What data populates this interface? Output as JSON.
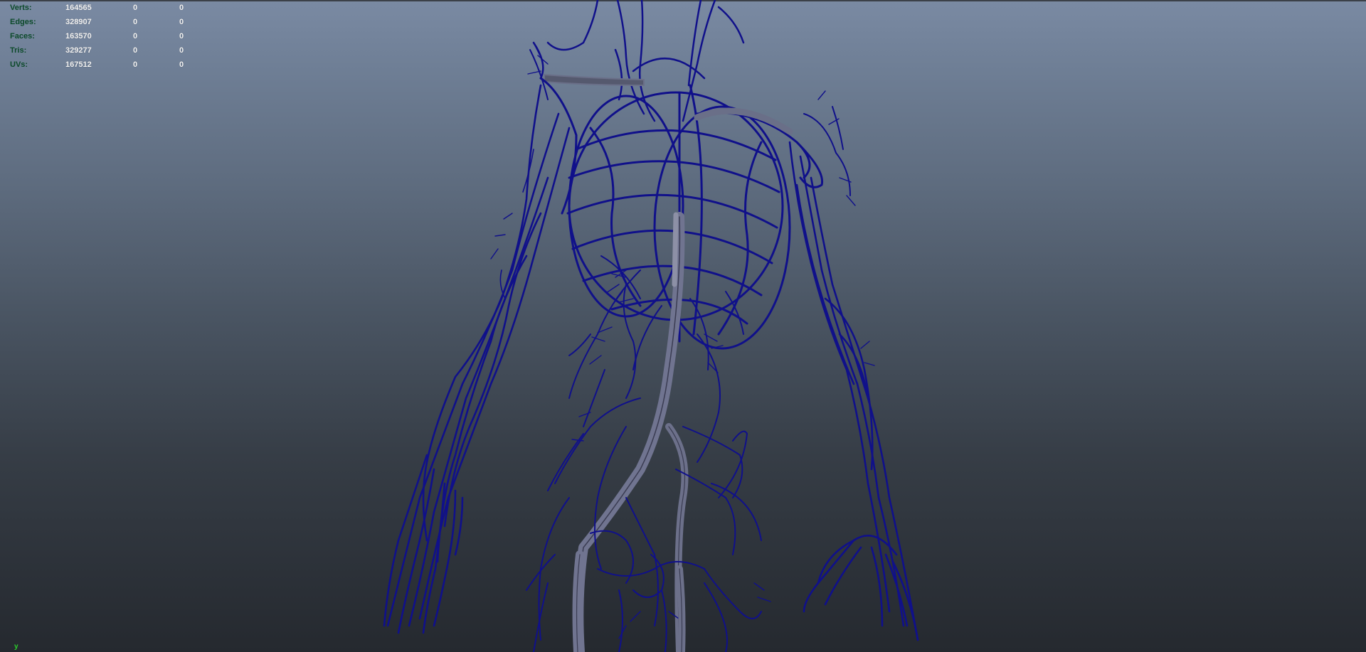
{
  "hud": {
    "rows": [
      {
        "label": "Verts:",
        "total": "164565",
        "selected": "0",
        "component": "0"
      },
      {
        "label": "Edges:",
        "total": "328907",
        "selected": "0",
        "component": "0"
      },
      {
        "label": "Faces:",
        "total": "163570",
        "selected": "0",
        "component": "0"
      },
      {
        "label": "Tris:",
        "total": "329277",
        "selected": "0",
        "component": "0"
      },
      {
        "label": "UVs:",
        "total": "167512",
        "selected": "0",
        "component": "0"
      }
    ]
  },
  "axis_label": "y",
  "colors": {
    "background_top": "#7a8aa3",
    "background_bottom": "#25292f",
    "wireframe": "#0f0f8c",
    "hud_label": "#0c4a2a",
    "hud_value": "#f2f2f2",
    "axis": "#2bd12b"
  },
  "icons": {
    "axis": "view-axis-icon"
  }
}
